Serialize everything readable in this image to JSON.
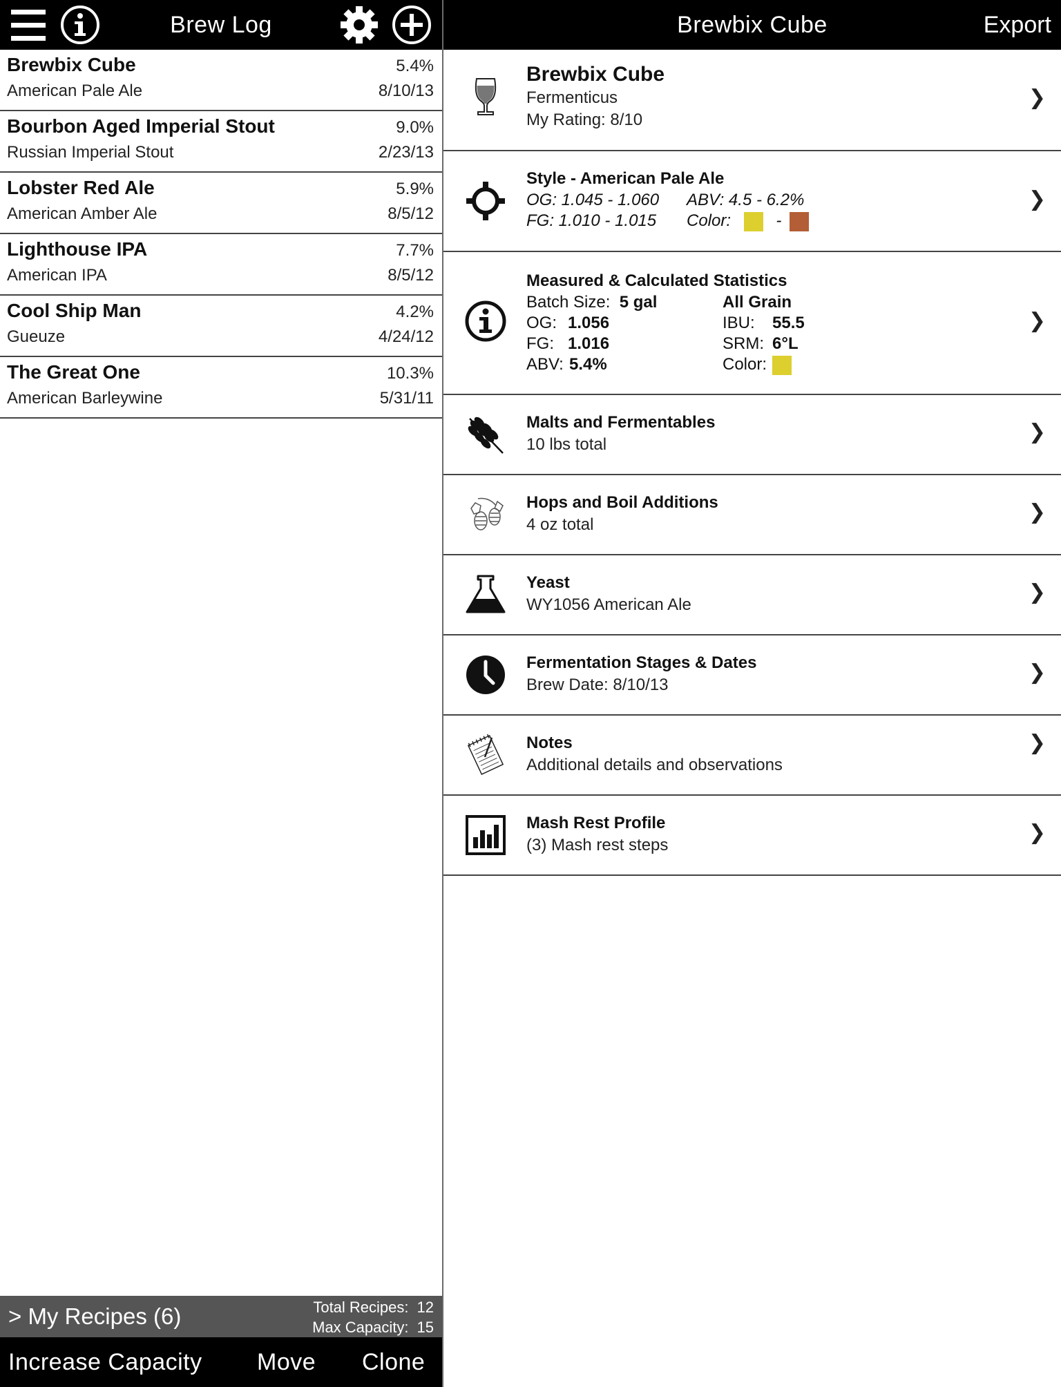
{
  "left_header": {
    "title": "Brew Log"
  },
  "recipes": [
    {
      "name": "Brewbix Cube",
      "style": "American Pale Ale",
      "abv": "5.4%",
      "date": "8/10/13"
    },
    {
      "name": "Bourbon Aged Imperial Stout",
      "style": "Russian Imperial Stout",
      "abv": "9.0%",
      "date": "2/23/13"
    },
    {
      "name": "Lobster Red Ale",
      "style": "American Amber Ale",
      "abv": "5.9%",
      "date": "8/5/12"
    },
    {
      "name": "Lighthouse IPA",
      "style": "American IPA",
      "abv": "7.7%",
      "date": "8/5/12"
    },
    {
      "name": "Cool Ship Man",
      "style": "Gueuze",
      "abv": "4.2%",
      "date": "4/24/12"
    },
    {
      "name": "The Great One",
      "style": "American Barleywine",
      "abv": "10.3%",
      "date": "5/31/11"
    }
  ],
  "folder": {
    "label": "> My Recipes (6)",
    "total_label": "Total Recipes:",
    "total_value": "12",
    "max_label": "Max Capacity:",
    "max_value": "15"
  },
  "bottom_bar": {
    "increase": "Increase Capacity",
    "move": "Move",
    "clone": "Clone"
  },
  "right_header": {
    "title": "Brewbix Cube",
    "export": "Export"
  },
  "details": {
    "recipe": {
      "name": "Brewbix Cube",
      "brewer": "Fermenticus",
      "rating": "My Rating:  8/10"
    },
    "style": {
      "title": "Style - American Pale Ale",
      "og": "OG: 1.045 - 1.060",
      "fg": "FG:  1.010 - 1.015",
      "abv": "ABV:   4.5 - 6.2%",
      "color_label": "Color:",
      "color_dash": "-",
      "color_low": "#dccf2e",
      "color_high": "#b35e36"
    },
    "stats": {
      "title": "Measured & Calculated Statistics",
      "batch_label": "Batch Size:",
      "batch_value": "5 gal",
      "og_label": "OG:",
      "og_value": "1.056",
      "fg_label": "FG:",
      "fg_value": "1.016",
      "abv_label": "ABV:",
      "abv_value": "5.4%",
      "method": "All Grain",
      "ibu_label": "IBU:",
      "ibu_value": "55.5",
      "srm_label": "SRM:",
      "srm_value": "6°L",
      "color_label": "Color:",
      "color": "#dccf2e"
    },
    "malts": {
      "title": "Malts and Fermentables",
      "sub": "10 lbs total"
    },
    "hops": {
      "title": "Hops and Boil Additions",
      "sub": "4 oz total"
    },
    "yeast": {
      "title": "Yeast",
      "sub": "WY1056 American Ale"
    },
    "fermentation": {
      "title": "Fermentation Stages & Dates",
      "sub": "Brew Date: 8/10/13"
    },
    "notes": {
      "title": "Notes",
      "sub": "Additional details and observations"
    },
    "mash": {
      "title": "Mash Rest Profile",
      "sub": "(3) Mash rest steps"
    }
  },
  "icons": {
    "menu": "menu-icon",
    "info": "info-icon",
    "settings": "gear-icon",
    "add": "plus-circle-icon",
    "glass": "tulip-glass-icon",
    "target": "crosshair-icon",
    "stats": "info-circle-icon",
    "wheat": "wheat-icon",
    "hops": "hops-icon",
    "flask": "flask-icon",
    "clock": "clock-icon",
    "notes": "notepad-icon",
    "chart": "bar-chart-icon",
    "chevron": "chevron-right-icon"
  }
}
